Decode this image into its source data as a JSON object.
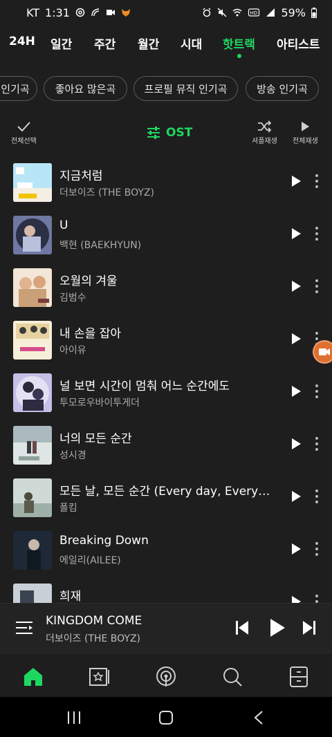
{
  "status_bar": {
    "carrier": "KT",
    "time": "1:31",
    "battery": "59%",
    "icons_left": [
      "at-icon",
      "wifi-calling-icon",
      "video-icon",
      "fox-app-icon"
    ],
    "icons_right": [
      "alarm-icon",
      "mute-icon",
      "wifi-icon",
      "hd-icon",
      "signal-icon",
      "battery-icon"
    ]
  },
  "tabs": [
    "24H",
    "일간",
    "주간",
    "월간",
    "시대",
    "핫트랙",
    "아티스트"
  ],
  "active_tab": "핫트랙",
  "chips": [
    "인기곡",
    "좋아요 많은곡",
    "프로필 뮤직 인기곡",
    "방송 인기곡"
  ],
  "toolbar": {
    "select_all": "전체선택",
    "filter": "OST",
    "shuffle": "셔플재생",
    "play_all": "전체재생"
  },
  "songs": [
    {
      "title": "지금처럼",
      "artist": "더보이즈 (THE BOYZ)"
    },
    {
      "title": "U",
      "artist": "백현 (BAEKHYUN)"
    },
    {
      "title": "오월의 겨울",
      "artist": "김범수"
    },
    {
      "title": "내 손을 잡아",
      "artist": "아이유"
    },
    {
      "title": "널 보면 시간이 멈춰 어느 순간에도",
      "artist": "투모로우바이투게더"
    },
    {
      "title": "너의 모든 순간",
      "artist": "성시경"
    },
    {
      "title": "모든 날, 모든 순간 (Every day, Every Moment)",
      "artist": "폴킴"
    },
    {
      "title": "Breaking Down",
      "artist": "에일리(AILEE)"
    },
    {
      "title": "희재",
      "artist": ""
    }
  ],
  "now_playing": {
    "title": "KINGDOM COME",
    "artist": "더보이즈 (THE BOYZ)"
  },
  "nav": [
    "home-icon",
    "library-icon",
    "podcast-icon",
    "search-icon",
    "drawer-icon"
  ],
  "colors": {
    "accent": "#1ed760",
    "background": "#1e1e1e",
    "chip_border": "#5a5a5a",
    "secondary_text": "#aaaaaa"
  }
}
